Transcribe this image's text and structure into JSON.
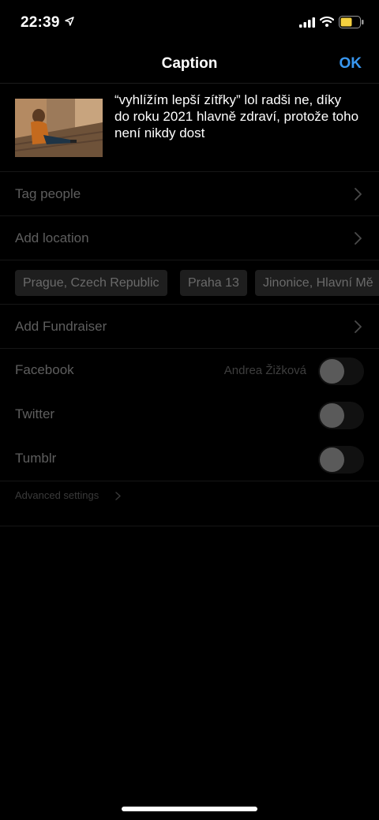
{
  "status_bar": {
    "time": "22:39",
    "icons": [
      "location-arrow-icon",
      "signal-icon",
      "wifi-icon",
      "battery-icon"
    ],
    "battery_color": "#f4d03f"
  },
  "nav": {
    "title": "Caption",
    "ok_label": "OK",
    "ok_color": "#3897f0"
  },
  "caption": {
    "text": "“vyhlížím lepší zítřky” lol radši ne, díky\ndo roku 2021 hlavně zdraví, protože toho není nikdy dost",
    "thumbnail_icon": "photo-thumbnail"
  },
  "rows": {
    "tag_people": "Tag people",
    "add_location": "Add location",
    "add_fundraiser": "Add Fundraiser"
  },
  "location_suggestions": [
    "Prague, Czech Republic",
    "Praha 13",
    "Jinonice, Hlavní Mě"
  ],
  "share": {
    "facebook": {
      "label": "Facebook",
      "account": "Andrea Žižková",
      "enabled": false
    },
    "twitter": {
      "label": "Twitter",
      "enabled": false
    },
    "tumblr": {
      "label": "Tumblr",
      "enabled": false
    }
  },
  "advanced_settings": "Advanced settings"
}
